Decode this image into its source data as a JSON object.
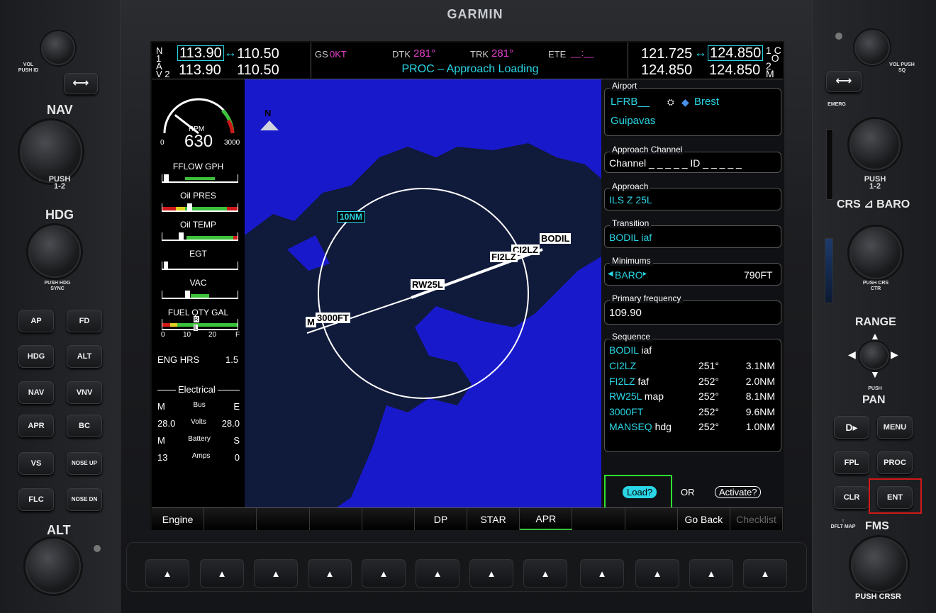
{
  "bezel": {
    "brand": "GARMIN",
    "left": {
      "vol_label": "VOL",
      "vol_push": "PUSH ID",
      "nav_label": "NAV",
      "nav_push": "PUSH 1-2",
      "hdg_label": "HDG",
      "hdg_push": "PUSH HDG SYNC",
      "alt_label": "ALT",
      "buttons": [
        "AP",
        "FD",
        "HDG",
        "ALT",
        "NAV",
        "VNV",
        "APR",
        "BC",
        "VS",
        "NOSE UP",
        "FLC",
        "NOSE DN"
      ]
    },
    "right": {
      "vol_label": "VOL",
      "vol_push": "PUSH SQ",
      "emerg": "EMERG",
      "com_push": "PUSH 1-2",
      "crs_baro": "CRS",
      "baro": "BARO",
      "crs_push": "PUSH CRS CTR",
      "range": "RANGE",
      "pan_push": "PUSH",
      "pan": "PAN",
      "buttons": [
        "D▸",
        "MENU",
        "FPL",
        "PROC",
        "CLR",
        "ENT"
      ],
      "dflt_map": "DFLT MAP",
      "fms": "FMS",
      "fms_push": "PUSH CRSR"
    }
  },
  "topbar": {
    "nav1_label": "N 1",
    "nav2_label": "A V 2",
    "nav1_active": "113.90",
    "nav1_standby": "110.50",
    "nav2_active": "113.90",
    "nav2_standby": "110.50",
    "gs_label": "GS",
    "gs_value": "0KT",
    "dtk_label": "DTK",
    "dtk_value": "281°",
    "trk_label": "TRK",
    "trk_value": "281°",
    "ete_label": "ETE",
    "ete_value": "__:__",
    "message": "PROC – Approach Loading",
    "com1_active": "121.725",
    "com1_standby": "124.850",
    "com2_active": "124.850",
    "com2_standby": "124.850",
    "com1_label": "1 C O",
    "com2_label": "2 M"
  },
  "eis": {
    "rpm_label": "RPM",
    "rpm_value": "630",
    "rpm_min": "0",
    "rpm_max": "3000",
    "rpm_fraction": 0.21,
    "fflow_label": "FFLOW GPH",
    "fflow_level": 0.02,
    "oil_pres_label": "Oil PRES",
    "oil_pres_level": 0.33,
    "oil_temp_label": "Oil TEMP",
    "oil_temp_level": 0.22,
    "egt_label": "EGT",
    "egt_level": 0.02,
    "vac_label": "VAC",
    "vac_level": 0.3,
    "fuel_label": "FUEL QTY GAL",
    "fuel_ticks": [
      "0",
      "10",
      "20",
      "F"
    ],
    "fuel_marker_r": "R",
    "fuel_marker_l": "L",
    "eng_hrs_label": "ENG HRS",
    "eng_hrs_value": "1.5",
    "electrical_label": "Electrical",
    "elec_rows": [
      {
        "left": "M",
        "mid": "Bus",
        "right": "E"
      },
      {
        "left": "28.0",
        "mid": "Volts",
        "right": "28.0"
      },
      {
        "left": "M",
        "mid": "Battery",
        "right": "S"
      },
      {
        "left": "13",
        "mid": "Amps",
        "right": "0"
      }
    ]
  },
  "map": {
    "north": "N",
    "range_label": "10NM",
    "waypoints": [
      "BODIL",
      "CI2LZ",
      "FI2LZ",
      "RW25L",
      "3000FT",
      "M"
    ]
  },
  "proc": {
    "airport_title": "Airport",
    "airport_ident": "LFRB__",
    "airport_city": "Brest",
    "airport_name": "Guipavas",
    "channel_title": "Approach Channel",
    "channel_text": "Channel _ _ _ _ _  ID _ _ _ _ _",
    "approach_title": "Approach",
    "approach_value": "ILS Z 25L",
    "transition_title": "Transition",
    "transition_value": "BODIL iaf",
    "minimums_title": "Minimums",
    "minimums_type": "BARO",
    "minimums_value": "790FT",
    "freq_title": "Primary frequency",
    "freq_value": "109.90",
    "sequence_title": "Sequence",
    "sequence_header": "BODIL iaf",
    "sequence": [
      {
        "wpt": "CI2LZ",
        "suffix": "",
        "crs": "251°",
        "dist": "3.1NM"
      },
      {
        "wpt": "FI2LZ",
        "suffix": " faf",
        "crs": "252°",
        "dist": "2.0NM"
      },
      {
        "wpt": "RW25L",
        "suffix": " map",
        "crs": "252°",
        "dist": "8.1NM"
      },
      {
        "wpt": "3000FT",
        "suffix": "",
        "crs": "252°",
        "dist": "9.6NM"
      },
      {
        "wpt": "MANSEQ",
        "suffix": " hdg",
        "crs": "252°",
        "dist": "1.0NM"
      }
    ],
    "load_button": "Load?",
    "or_text": "OR",
    "activate_button": "Activate?"
  },
  "softkeys": [
    "Engine",
    "",
    "",
    "",
    "",
    "DP",
    "STAR",
    "APR",
    "",
    "",
    "Go Back",
    "Checklist"
  ],
  "colors": {
    "cyan": "#2ad6e6",
    "magenta": "#e040c8",
    "green": "#3cc13c",
    "map_blue": "#1919cc",
    "highlight_green": "#2fe02f",
    "highlight_red": "#d01818"
  }
}
